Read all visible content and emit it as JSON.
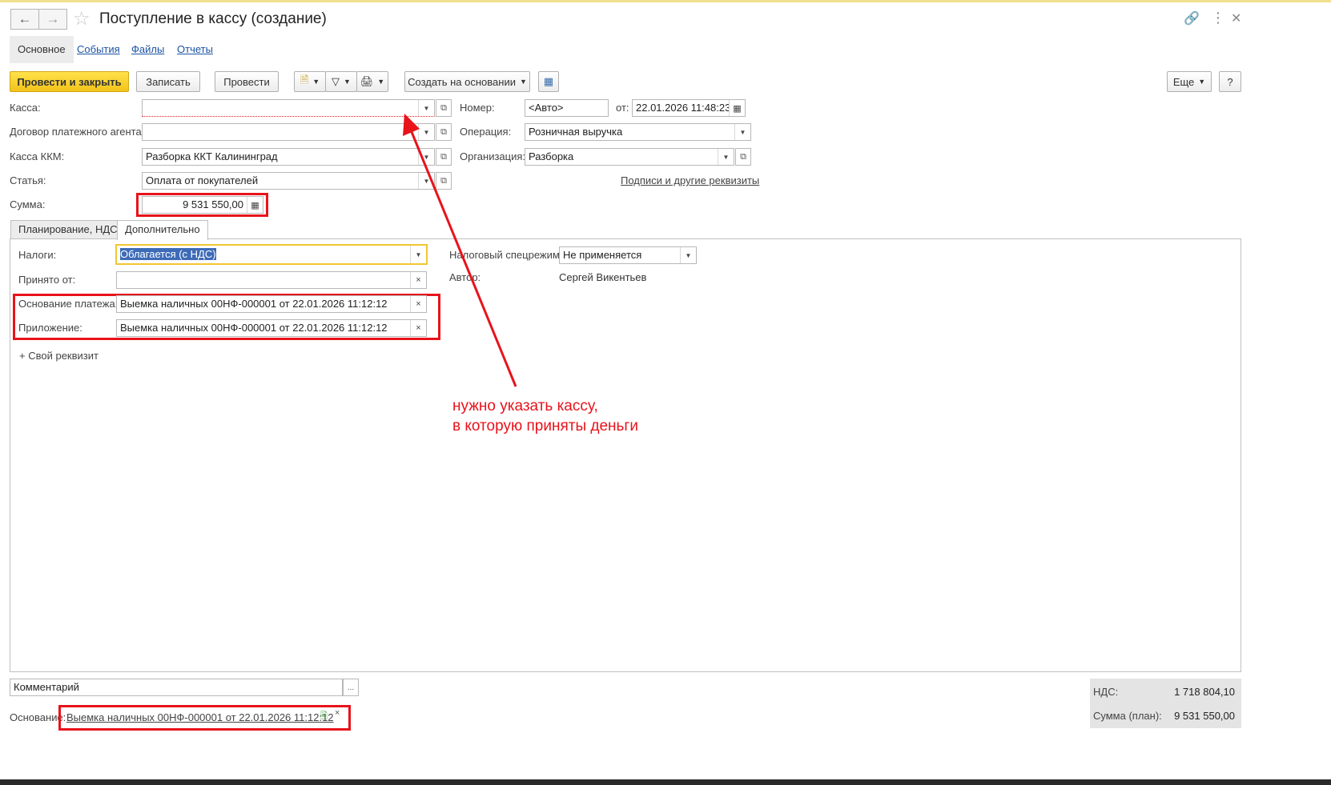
{
  "window": {
    "title": "Поступление в кассу (создание)",
    "back_icon": "arrow-left-icon",
    "forward_icon": "arrow-right-icon",
    "favorite_icon": "star-icon",
    "header_icons": [
      "link-icon",
      "more-vert-icon",
      "close-icon"
    ]
  },
  "sections": [
    "Основное",
    "События",
    "Файлы",
    "Отчеты"
  ],
  "toolbar": {
    "post_close": "Провести и закрыть",
    "save": "Записать",
    "post": "Провести",
    "create_based": "Создать на основании",
    "more": "Еще",
    "help": "?"
  },
  "fields": {
    "kassa": {
      "label": "Касса:",
      "value": ""
    },
    "dogovor": {
      "label": "Договор платежного агента:",
      "value": ""
    },
    "kassa_kkm": {
      "label": "Касса ККМ:",
      "value": "Разборка ККТ Калининград"
    },
    "statya": {
      "label": "Статья:",
      "value": "Оплата от покупателей"
    },
    "summa": {
      "label": "Сумма:",
      "value": "9 531 550,00"
    },
    "nomer": {
      "label": "Номер:",
      "placeholder": "<Авто>"
    },
    "date": {
      "label": "от:",
      "value": "22.01.2026 11:48:23"
    },
    "operaciya": {
      "label": "Операция:",
      "value": "Розничная выручка"
    },
    "organizaciya": {
      "label": "Организация:",
      "value": "Разборка"
    },
    "signatures_link": "Подписи и другие реквизиты"
  },
  "tabs": [
    "Планирование, НДС",
    "Дополнительно"
  ],
  "extra": {
    "nalogi": {
      "label": "Налоги:",
      "value": "Облагается (с НДС)"
    },
    "prinyato": {
      "label": "Принято от:",
      "value": ""
    },
    "osnovanie": {
      "label": "Основание платежа:",
      "value": "Выемка наличных 00НФ-000001 от 22.01.2026 11:12:12"
    },
    "prilozhenie": {
      "label": "Приложение:",
      "value": "Выемка наличных 00НФ-000001 от 22.01.2026 11:12:12"
    },
    "custom_attr": "Свой реквизит",
    "nalog_rezhim": {
      "label": "Налоговый спецрежим:",
      "value": "Не применяется"
    },
    "avtor": {
      "label": "Автор:",
      "value": "Сергей Викентьев"
    }
  },
  "annotation": {
    "line1": "нужно указать кассу,",
    "line2": "в которую приняты деньги"
  },
  "footer": {
    "comment_placeholder": "Комментарий",
    "comment_btn": "...",
    "basis_label": "Основание:",
    "basis_link": "Выемка наличных 00НФ-000001 от 22.01.2026 11:12:12",
    "nds_label": "НДС:",
    "nds_value": "1 718 804,10",
    "sum_label": "Сумма (план):",
    "sum_value": "9 531 550,00"
  },
  "colors": {
    "highlight": "#e8131b",
    "primary_button": "#f2c31a",
    "link": "#1b52a3"
  }
}
